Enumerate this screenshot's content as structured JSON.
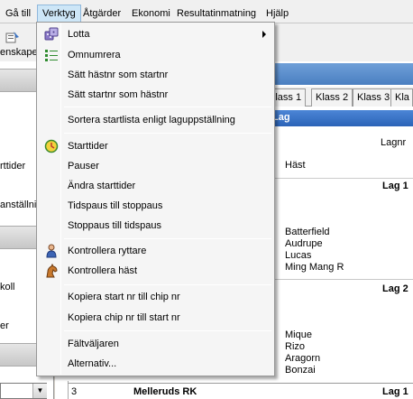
{
  "menubar": {
    "items": [
      "Gå till",
      "Verktyg",
      "Åtgärder",
      "Ekonomi",
      "Resultatinmatning",
      "Hjälp"
    ]
  },
  "toolbar": {
    "button_label": "enskaper"
  },
  "left_panel": {
    "texts": [
      "rttider",
      "anställnir",
      "koll",
      "er"
    ],
    "combo_arrow": "▼"
  },
  "main": {
    "tabs": [
      "Klass 1",
      "Klass 2",
      "Klass 3",
      "Kla"
    ],
    "lag_header": "Lag",
    "columns": {
      "lagnr": "Lagnr",
      "hast": "Häst"
    },
    "teams": [
      {
        "label": "Lag 1",
        "horses": [
          "Batterfield",
          "Audrupe",
          "Lucas",
          "Ming Mang R"
        ]
      },
      {
        "label": "Lag 2",
        "horses": [
          "Mique",
          "Rizo",
          "Aragorn",
          "Bonzai"
        ]
      }
    ],
    "bottom_row": {
      "number": "3",
      "club": "Melleruds RK",
      "lag": "Lag 1"
    }
  },
  "menu": {
    "items": [
      {
        "label": "Lotta",
        "icon": "dice-icon",
        "submenu": true
      },
      {
        "label": "Omnumrera",
        "icon": "numbered-list-icon"
      },
      {
        "label": "Sätt hästnr som startnr"
      },
      {
        "label": "Sätt startnr som hästnr"
      },
      {
        "label": "Sortera startlista enligt laguppställning"
      },
      {
        "label": "Starttider",
        "icon": "clock-icon"
      },
      {
        "label": "Pauser"
      },
      {
        "label": "Ändra starttider"
      },
      {
        "label": "Tidspaus till stoppaus"
      },
      {
        "label": "Stoppaus till tidspaus"
      },
      {
        "label": "Kontrollera ryttare",
        "icon": "rider-icon"
      },
      {
        "label": "Kontrollera häst",
        "icon": "horse-icon"
      },
      {
        "label": "Kopiera start nr till chip nr"
      },
      {
        "label": "Kopiera chip nr till start nr"
      },
      {
        "label": "Fältväljaren"
      },
      {
        "label": "Alternativ..."
      }
    ]
  }
}
